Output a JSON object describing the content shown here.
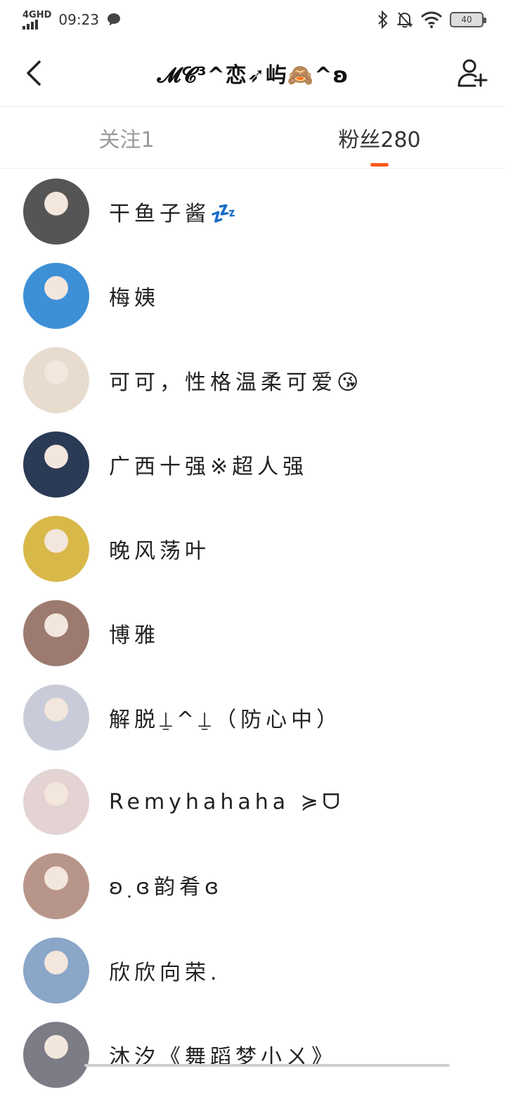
{
  "status_bar": {
    "network": "4GHD",
    "time": "09:23",
    "battery": "40",
    "icons": [
      "chat-bubble-icon",
      "bluetooth-icon",
      "mute-bell-icon",
      "wifi-icon",
      "battery-icon"
    ]
  },
  "header": {
    "title": "𝓜𝓒³^恋➶屿🙈^ʚ",
    "back_icon": "chevron-left-icon",
    "add_icon": "add-user-icon"
  },
  "tabs": {
    "following_label": "关注1",
    "fans_label": "粉丝280",
    "active": "fans",
    "accent": "#ff5a1f"
  },
  "fans": [
    {
      "name": "干鱼子酱💤",
      "color": "#555555"
    },
    {
      "name": "梅姨",
      "color": "#3d8fd6"
    },
    {
      "name": "可可，性格温柔可爱😘",
      "color": "#e8dccf"
    },
    {
      "name": "广西十强※超人强",
      "color": "#2b3a55"
    },
    {
      "name": "晚风荡叶",
      "color": "#d9b84a"
    },
    {
      "name": "博雅",
      "color": "#9c7a70"
    },
    {
      "name": "解脱⍊^⍊（防心中）",
      "color": "#c9ccd8"
    },
    {
      "name": "Remyhahaha ≽ᗜ",
      "color": "#e4d3d3"
    },
    {
      "name": "ʚ຺ɞ韵肴ɞ",
      "color": "#b8958a"
    },
    {
      "name": "欣欣向荣.",
      "color": "#8aa6c8"
    },
    {
      "name": "沐汐《舞蹈梦小ㄨ》",
      "color": "#7c7c86"
    }
  ]
}
